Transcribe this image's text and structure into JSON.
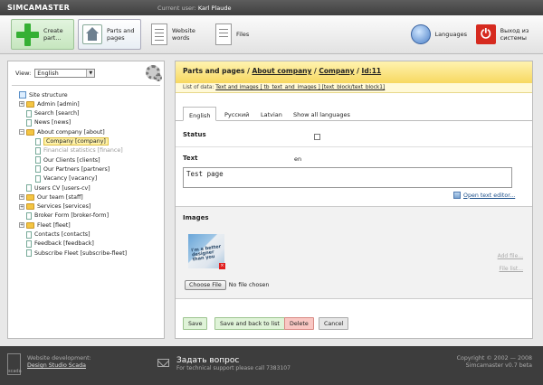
{
  "app": {
    "logo": "SIMCAMASTER",
    "current_user_label": "Current user:",
    "current_user": "Karl Plaude"
  },
  "toolbar": {
    "create": "Create part...",
    "parts": "Parts and pages",
    "words": "Website words",
    "files": "Files",
    "languages": "Languages",
    "logout": "Выход из системы"
  },
  "left": {
    "view_label": "View:",
    "view_value": "English",
    "tree": [
      {
        "label": "Site structure",
        "level": 0,
        "kind": "root"
      },
      {
        "label": "Admin [admin]",
        "level": 1,
        "kind": "folder",
        "toggle": "+"
      },
      {
        "label": "Search [search]",
        "level": 1,
        "kind": "page"
      },
      {
        "label": "News [news]",
        "level": 1,
        "kind": "page"
      },
      {
        "label": "About company [about]",
        "level": 1,
        "kind": "folder",
        "toggle": "−"
      },
      {
        "label": "Company [company]",
        "level": 2,
        "kind": "page",
        "selected": true
      },
      {
        "label": "Financial statistics [finance]",
        "level": 2,
        "kind": "page",
        "disabled": true
      },
      {
        "label": "Our Clients [clients]",
        "level": 2,
        "kind": "page"
      },
      {
        "label": "Our Partners [partners]",
        "level": 2,
        "kind": "page"
      },
      {
        "label": "Vacancy [vacancy]",
        "level": 2,
        "kind": "page"
      },
      {
        "label": "Users CV [users-cv]",
        "level": 1,
        "kind": "page"
      },
      {
        "label": "Our team [staff]",
        "level": 1,
        "kind": "folder",
        "toggle": "+"
      },
      {
        "label": "Services [services]",
        "level": 1,
        "kind": "folder",
        "toggle": "+"
      },
      {
        "label": "Broker Form [broker-form]",
        "level": 1,
        "kind": "page"
      },
      {
        "label": "Fleet [fleet]",
        "level": 1,
        "kind": "folder",
        "toggle": "+"
      },
      {
        "label": "Contacts [contacts]",
        "level": 1,
        "kind": "page"
      },
      {
        "label": "Feedback [feedback]",
        "level": 1,
        "kind": "page"
      },
      {
        "label": "Subscribe Fleet [subscribe-fleet]",
        "level": 1,
        "kind": "page"
      }
    ]
  },
  "main": {
    "crumb_root": "Parts and pages",
    "sep": "/",
    "crumb_1": "About company",
    "crumb_2": "Company",
    "crumb_3": "Id:11",
    "list_of_label": "List of data:",
    "list_of_value": "Text and images [ tb_text_and_images ] [text_block/text_block1]",
    "tabs": [
      "English",
      "Русский",
      "Latvian",
      "Show all languages"
    ],
    "status_label": "Status",
    "text_label": "Text",
    "text_lang": "en",
    "text_value": "Test page",
    "open_editor": "Open text editor...",
    "images_label": "Images",
    "image_caption": "I'm a better designer than you",
    "add_file": "Add file...",
    "file_list": "File list...",
    "choose_file": "Choose File",
    "no_file": "No file chosen",
    "buttons": {
      "save": "Save",
      "save_back": "Save and back to list",
      "delete": "Delete",
      "cancel": "Cancel"
    }
  },
  "footer": {
    "scada_label": "scada",
    "dev_label": "Website development:",
    "dev_link": "Design Studio Scada",
    "ask_title": "Задать вопрос",
    "ask_sub": "For technical support please call 7383107",
    "copyright": "Copyright © 2002 — 2008",
    "version": "Simcamaster v0.7 beta"
  }
}
